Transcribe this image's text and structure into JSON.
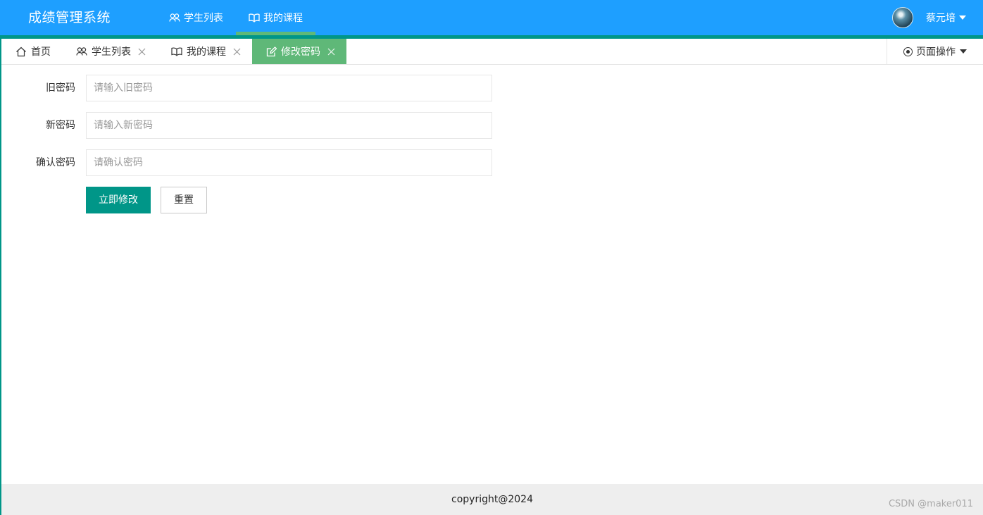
{
  "header": {
    "logo": "成绩管理系统",
    "nav": [
      {
        "label": "学生列表",
        "icon": "users-icon"
      },
      {
        "label": "我的课程",
        "icon": "book-icon",
        "active": true
      }
    ],
    "user": {
      "name": "蔡元培"
    }
  },
  "tabs": [
    {
      "label": "首页",
      "icon": "home-icon",
      "closable": false
    },
    {
      "label": "学生列表",
      "icon": "users-icon",
      "closable": true
    },
    {
      "label": "我的课程",
      "icon": "book-icon",
      "closable": true
    },
    {
      "label": "修改密码",
      "icon": "edit-icon",
      "closable": true,
      "active": true
    }
  ],
  "page_ops": {
    "label": "页面操作"
  },
  "form": {
    "old_password": {
      "label": "旧密码",
      "placeholder": "请输入旧密码"
    },
    "new_password": {
      "label": "新密码",
      "placeholder": "请输入新密码"
    },
    "confirm_password": {
      "label": "确认密码",
      "placeholder": "请确认密码"
    },
    "submit_label": "立即修改",
    "reset_label": "重置"
  },
  "footer": {
    "copyright": "copyright@2024"
  },
  "watermark": "CSDN @maker011",
  "colors": {
    "header": "#1e9fff",
    "accent": "#009688",
    "active_tab": "#5fb878",
    "footer": "#eeeeee"
  }
}
